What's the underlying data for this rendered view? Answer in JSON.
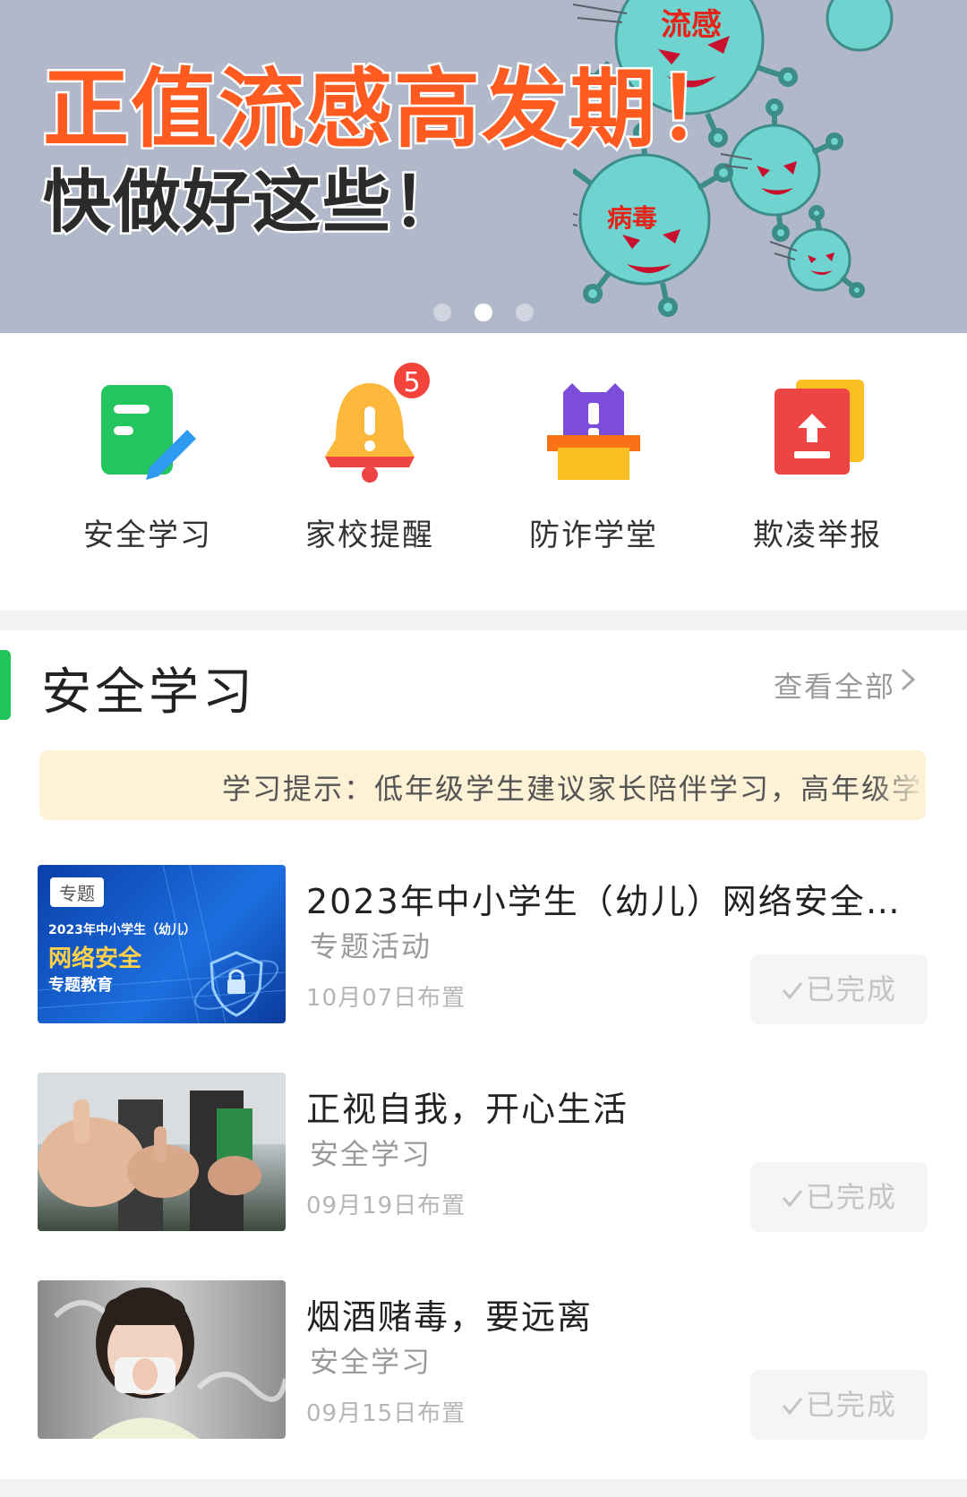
{
  "banner": {
    "title_line1": "正值流感高发期！",
    "title_line2": "快做好这些！",
    "virus_label_1": "流感",
    "virus_label_2": "病毒",
    "pager_count": 3,
    "pager_active_index": 1,
    "bg_color": "#b1b8c9"
  },
  "quick_actions": [
    {
      "label": "安全学习",
      "icon": "note-pencil-icon",
      "color": "#22c55e"
    },
    {
      "label": "家校提醒",
      "icon": "bell-icon",
      "color": "#f59e0b",
      "badge": "5"
    },
    {
      "label": "防诈学堂",
      "icon": "shield-box-icon",
      "color": "#8b5cf6"
    },
    {
      "label": "欺凌举报",
      "icon": "upload-report-icon",
      "color": "#ef4444"
    }
  ],
  "section": {
    "title": "安全学习",
    "view_all": "查看全部",
    "tip": "学习提示：低年级学生建议家长陪伴学习，高年级学",
    "items": [
      {
        "title": "2023年中小学生（幼儿）网络安全专...",
        "category": "专题活动",
        "date": "10月07日布置",
        "status": "已完成",
        "thumb": {
          "tag": "专题",
          "line1": "2023年中小学生（幼儿）",
          "line2": "网络安全",
          "line3": "专题教育"
        }
      },
      {
        "title": "正视自我，开心生活",
        "category": "安全学习",
        "date": "09月19日布置",
        "status": "已完成"
      },
      {
        "title": "烟酒赌毒，要远离",
        "category": "安全学习",
        "date": "09月15日布置",
        "status": "已完成"
      }
    ]
  },
  "colors": {
    "accent_green": "#20c55a",
    "badge_red": "#f4433a",
    "tip_bg": "#fdf1d6"
  }
}
